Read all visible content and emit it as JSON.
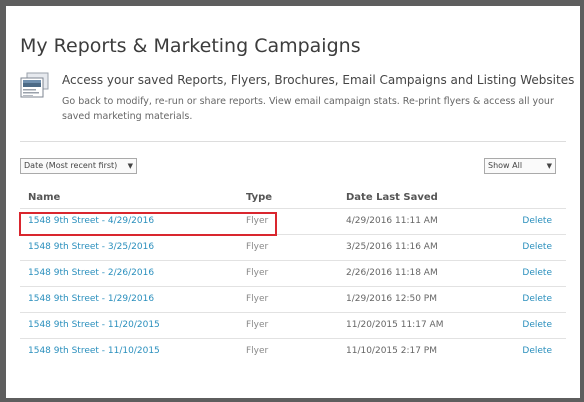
{
  "page": {
    "title": "My Reports & Marketing Campaigns"
  },
  "intro": {
    "icon": "reports-icon",
    "heading": "Access your saved Reports, Flyers, Brochures, Email Campaigns and Listing Websites",
    "body": "Go back to modify, re-run or share reports. View email campaign stats. Re-print flyers & access all your saved marketing materials."
  },
  "controls": {
    "sort_value": "Date (Most recent first)",
    "filter_value": "Show All"
  },
  "table": {
    "headers": {
      "name": "Name",
      "type": "Type",
      "date": "Date Last Saved"
    },
    "rows": [
      {
        "name": "1548 9th Street - 4/29/2016",
        "type": "Flyer",
        "date": "4/29/2016 11:11 AM",
        "action": "Delete"
      },
      {
        "name": "1548 9th Street - 3/25/2016",
        "type": "Flyer",
        "date": "3/25/2016 11:16 AM",
        "action": "Delete"
      },
      {
        "name": "1548 9th Street - 2/26/2016",
        "type": "Flyer",
        "date": "2/26/2016 11:18 AM",
        "action": "Delete"
      },
      {
        "name": "1548 9th Street - 1/29/2016",
        "type": "Flyer",
        "date": "1/29/2016 12:50 PM",
        "action": "Delete"
      },
      {
        "name": "1548 9th Street - 11/20/2015",
        "type": "Flyer",
        "date": "11/20/2015 11:17 AM",
        "action": "Delete"
      },
      {
        "name": "1548 9th Street - 11/10/2015",
        "type": "Flyer",
        "date": "11/10/2015 2:17 PM",
        "action": "Delete"
      }
    ]
  },
  "colors": {
    "link": "#2a8fbd",
    "highlight": "#d9262e",
    "frame": "#5e5e5e"
  }
}
